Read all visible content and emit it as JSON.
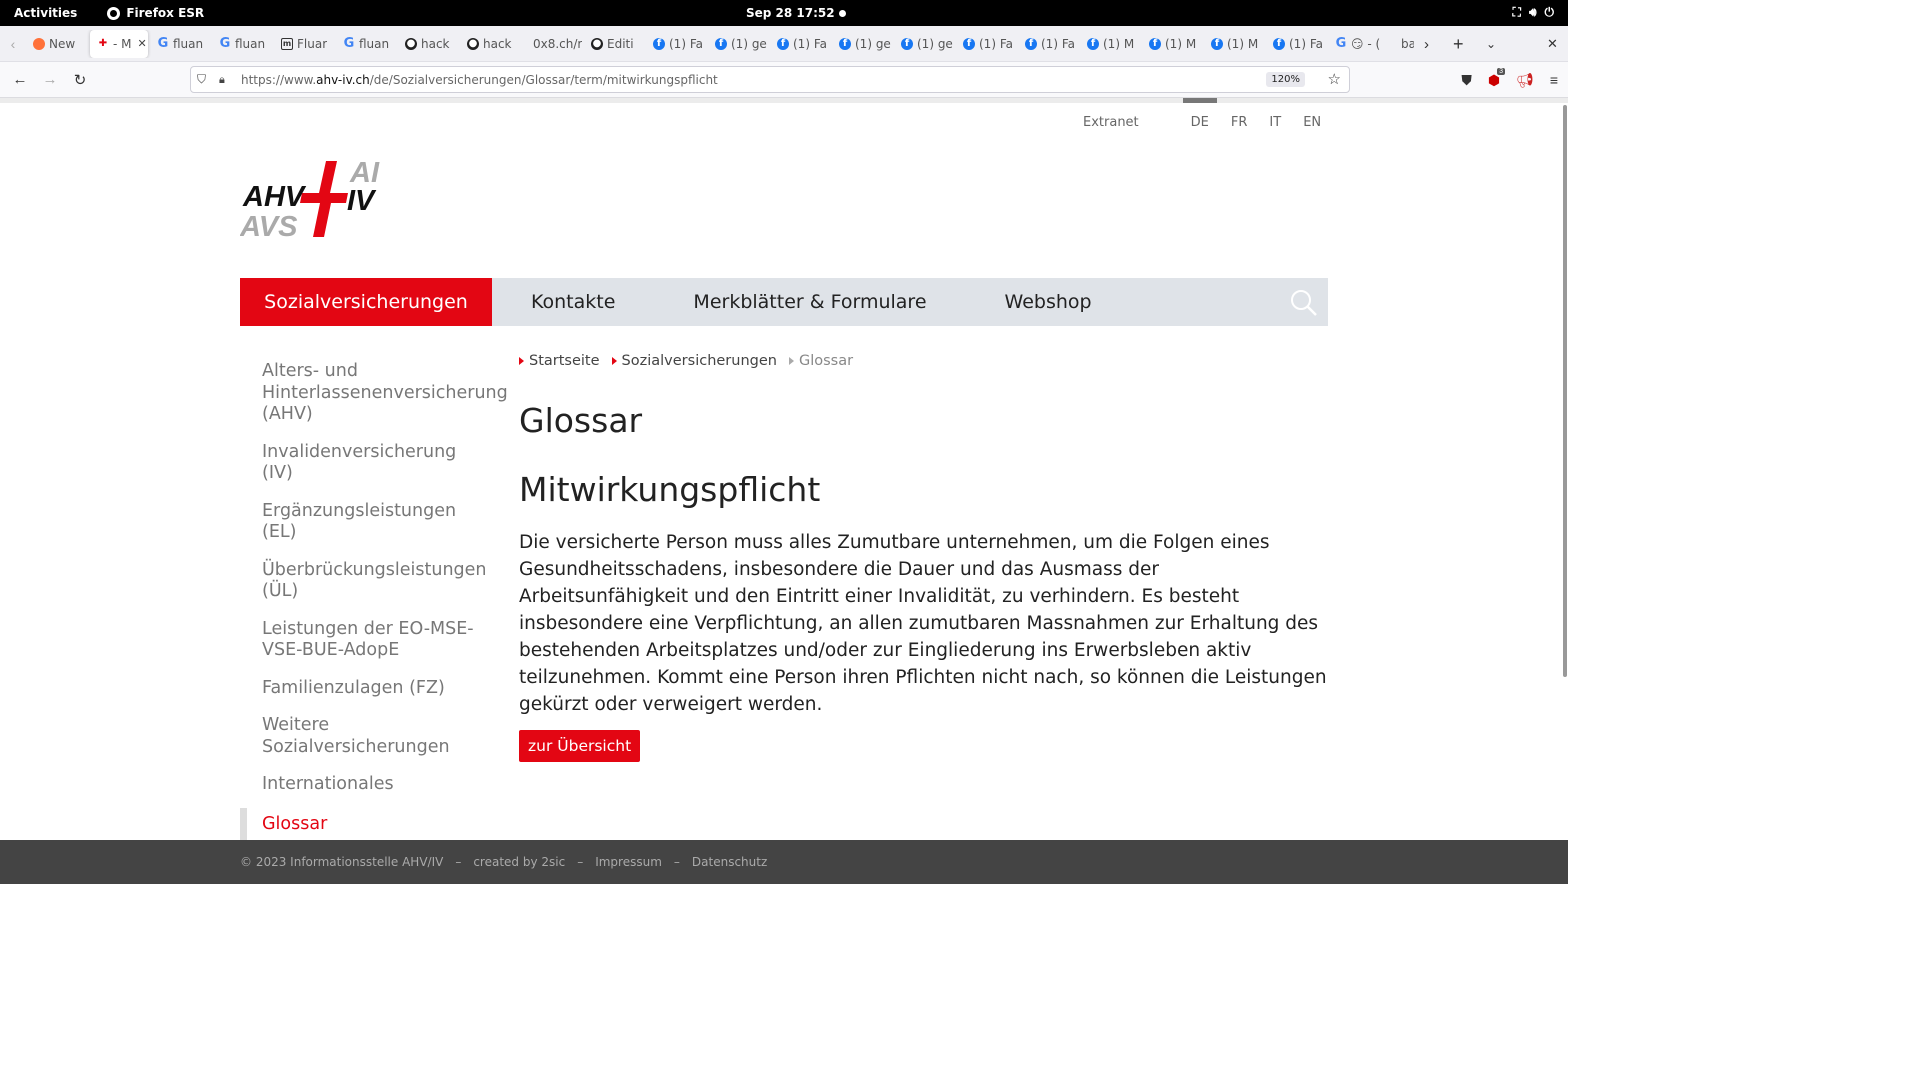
{
  "system_bar": {
    "activities": "Activities",
    "app_name": "Firefox ESR",
    "clock": "Sep 28  17:52",
    "icons": [
      "network-icon",
      "volume-icon",
      "power-icon"
    ]
  },
  "tabs": [
    {
      "label": "New",
      "icon": "firefox-icon",
      "fav": "ff",
      "active": false
    },
    {
      "label": "- M",
      "icon": "ahv-favicon",
      "fav": "ahv",
      "active": true
    },
    {
      "label": "fluan",
      "icon": "google-icon",
      "fav": "g",
      "active": false
    },
    {
      "label": "fluan",
      "icon": "google-icon",
      "fav": "g",
      "active": false
    },
    {
      "label": "Fluar",
      "icon": "wiki-icon",
      "fav": "wiki",
      "active": false
    },
    {
      "label": "fluan",
      "icon": "google-icon",
      "fav": "g",
      "active": false
    },
    {
      "label": "hack",
      "icon": "github-icon",
      "fav": "gh",
      "active": false
    },
    {
      "label": "hack",
      "icon": "github-icon",
      "fav": "gh",
      "active": false
    },
    {
      "label": "0x8.ch/r",
      "icon": "",
      "fav": "none",
      "active": false
    },
    {
      "label": "Editi",
      "icon": "github-icon",
      "fav": "gh",
      "active": false
    },
    {
      "label": "(1) Fa",
      "icon": "facebook-icon",
      "fav": "fb",
      "active": false
    },
    {
      "label": "(1) ge",
      "icon": "facebook-icon",
      "fav": "fb",
      "active": false
    },
    {
      "label": "(1) Fa",
      "icon": "facebook-icon",
      "fav": "fb",
      "active": false
    },
    {
      "label": "(1) ge",
      "icon": "facebook-icon",
      "fav": "fb",
      "active": false
    },
    {
      "label": "(1) ge",
      "icon": "facebook-icon",
      "fav": "fb",
      "active": false
    },
    {
      "label": "(1) Fa",
      "icon": "facebook-icon",
      "fav": "fb",
      "active": false
    },
    {
      "label": "(1) Fa",
      "icon": "facebook-icon",
      "fav": "fb",
      "active": false
    },
    {
      "label": "(1) M",
      "icon": "facebook-icon",
      "fav": "fb",
      "active": false
    },
    {
      "label": "(1) M",
      "icon": "facebook-icon",
      "fav": "fb",
      "active": false
    },
    {
      "label": "(1) M",
      "icon": "facebook-icon",
      "fav": "fb",
      "active": false
    },
    {
      "label": "(1) Fa",
      "icon": "facebook-icon",
      "fav": "fb",
      "active": false
    },
    {
      "label": "😏 - (",
      "icon": "google-icon",
      "fav": "g",
      "active": false
    },
    {
      "label": "bab",
      "icon": "",
      "fav": "none",
      "active": false
    }
  ],
  "navbar": {
    "url_prefix": "https://www.",
    "url_domain": "ahv-iv.ch",
    "url_path": "/de/Sozialversicherungen/Glossar/term/mitwirkungspflicht",
    "zoom": "120%",
    "extension_badge": "3"
  },
  "meta_nav": {
    "extranet": "Extranet",
    "languages": [
      "DE",
      "FR",
      "IT",
      "EN"
    ],
    "active_language": "DE"
  },
  "logo": {
    "line1": "AHV",
    "line2": "AVS",
    "line3": "AI",
    "line4": "IV"
  },
  "main_nav": [
    {
      "label": "Sozialversicherungen",
      "active": true
    },
    {
      "label": "Kontakte",
      "active": false
    },
    {
      "label": "Merkblätter & Formulare",
      "active": false
    },
    {
      "label": "Webshop",
      "active": false
    }
  ],
  "sidebar": [
    {
      "label": "Alters- und Hinterlassenenversicherung (AHV)",
      "active": false
    },
    {
      "label": "Invalidenversicherung (IV)",
      "active": false
    },
    {
      "label": "Ergänzungsleistungen (EL)",
      "active": false
    },
    {
      "label": "Überbrückungsleistungen (ÜL)",
      "active": false
    },
    {
      "label": "Leistungen der EO-MSE-VSE-BUE-AdopE",
      "active": false
    },
    {
      "label": "Familienzulagen (FZ)",
      "active": false
    },
    {
      "label": "Weitere Sozialversicherungen",
      "active": false
    },
    {
      "label": "Internationales",
      "active": false
    },
    {
      "label": "Glossar",
      "active": true
    }
  ],
  "breadcrumb": [
    "Startseite",
    "Sozialversicherungen",
    "Glossar"
  ],
  "content": {
    "page_title": "Glossar",
    "term_title": "Mitwirkungspflicht",
    "definition": "Die versicherte Person muss alles Zumutbare unternehmen, um die Folgen eines Gesundheitsschadens, insbesondere die Dauer und das Ausmass der Arbeitsunfähigkeit und den Eintritt einer Invalidität, zu verhindern. Es besteht insbesondere eine Verpflichtung, an allen zumutbaren Massnahmen zur Erhaltung des bestehenden Arbeitsplatzes und/oder zur Eingliederung ins Erwerbsleben aktiv teilzunehmen. Kommt eine Person ihren Pflichten nicht nach, so können die Leistungen gekürzt oder verweigert werden.",
    "back_button": "zur Übersicht"
  },
  "footer": {
    "copyright": "© 2023 Informationsstelle AHV/IV",
    "sep": "–",
    "created_by": "created by 2sic",
    "impressum": "Impressum",
    "datenschutz": "Datenschutz"
  },
  "colors": {
    "brand_red": "#e30613",
    "nav_bg": "#dfe3e8",
    "footer_bg": "#444444"
  }
}
